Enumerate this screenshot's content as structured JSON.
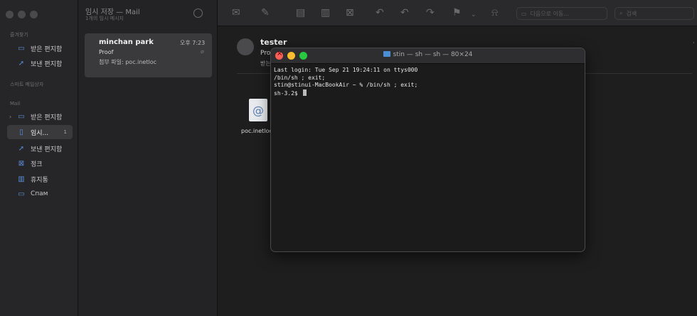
{
  "sidebar": {
    "favorites_label": "즐겨찾기",
    "fav_items": [
      {
        "label": "받은 편지함",
        "icon": "tray-icon"
      },
      {
        "label": "보낸 편지함",
        "icon": "paperplane-icon"
      }
    ],
    "smart_label": "스마트 메일상자",
    "mail_label": "Mail",
    "mail_items": [
      {
        "label": "받은 편지함",
        "icon": "tray-icon"
      },
      {
        "label": "임시...",
        "icon": "document-icon",
        "badge": "1"
      },
      {
        "label": "보낸 편지함",
        "icon": "paperplane-icon"
      },
      {
        "label": "정크",
        "icon": "junk-icon"
      },
      {
        "label": "휴지통",
        "icon": "trash-icon"
      },
      {
        "label": "Спам",
        "icon": "folder-icon"
      }
    ]
  },
  "message_list": {
    "title": "임시 저장 — Mail",
    "subtitle": "1개의 임시 메시지",
    "message": {
      "sender": "minchan park",
      "time": "오후 7:23",
      "subject": "Proof",
      "attachment": "첨부 파일: poc.inetloc"
    }
  },
  "toolbar": {
    "move_placeholder": "다음으로 이동...",
    "search_placeholder": "검색"
  },
  "reader": {
    "from": "tester",
    "subject": "Proof",
    "to": "받는",
    "attachment_name": "poc.inetloc"
  },
  "terminal": {
    "title": "stin — sh — sh — 80×24",
    "lines": [
      "Last login: Tue Sep 21 19:24:11 on ttys000",
      "/bin/sh ; exit;",
      "stin@stinui-MacBookAir ~ % /bin/sh ; exit;",
      "sh-3.2$ "
    ]
  },
  "colors": {
    "accent": "#5a8fd9",
    "close": "#ff5f57",
    "minimize": "#febc2e",
    "maximize": "#28c840"
  }
}
